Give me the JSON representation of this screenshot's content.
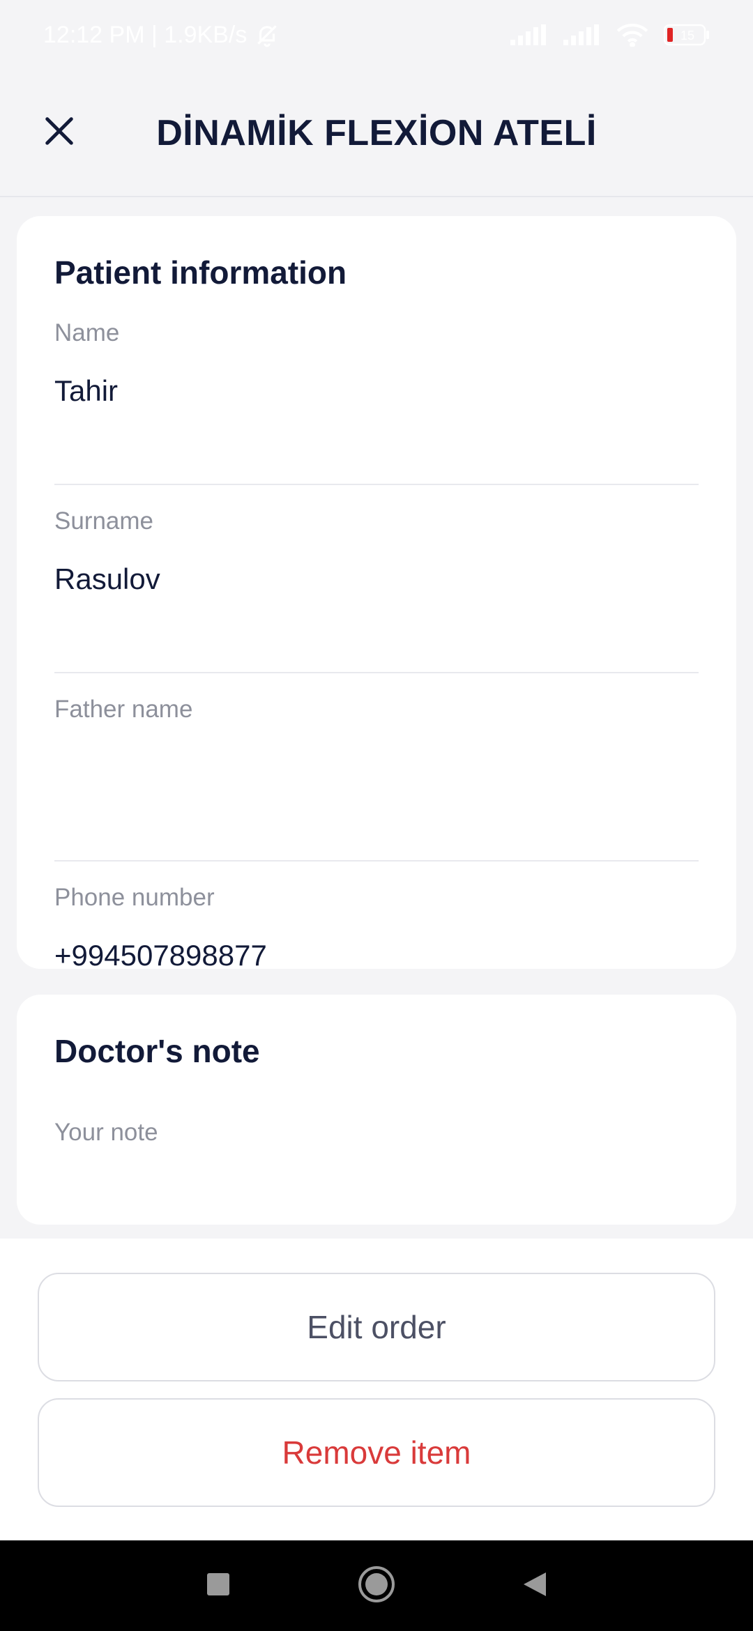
{
  "status_bar": {
    "time_and_speed": "12:12 PM | 1.9KB/s",
    "battery_level": "15",
    "icons": [
      "bell-off-icon",
      "signal-icon",
      "signal-icon",
      "wifi-icon",
      "battery-icon"
    ]
  },
  "header": {
    "title": "DİNAMİK FLEXİON ATELİ",
    "close_icon": "close-icon"
  },
  "patient_info": {
    "title": "Patient information",
    "fields": [
      {
        "label": "Name",
        "value": "Tahir"
      },
      {
        "label": "Surname",
        "value": "Rasulov"
      },
      {
        "label": "Father name",
        "value": ""
      },
      {
        "label": "Phone number",
        "value": "+994507898877"
      }
    ]
  },
  "doctor_note": {
    "title": "Doctor's note",
    "placeholder": "Your note"
  },
  "actions": {
    "edit_label": "Edit order",
    "remove_label": "Remove item"
  },
  "nav_bar": {
    "icons": [
      "recents-icon",
      "home-icon",
      "back-icon"
    ]
  },
  "colors": {
    "primary_text": "#121a38",
    "secondary_text": "#8d909b",
    "danger": "#d93a3a",
    "background": "#f4f4f6",
    "card": "#ffffff"
  }
}
